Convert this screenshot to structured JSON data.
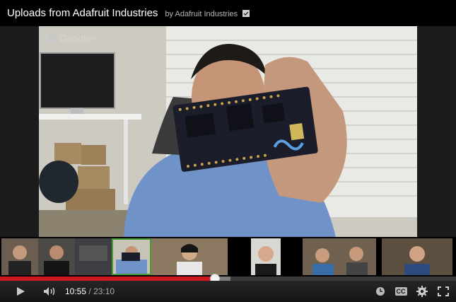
{
  "header": {
    "title": "Uploads from Adafruit Industries",
    "byline": "by Adafruit Industries"
  },
  "video": {
    "watermark": "Google+"
  },
  "participants": [
    {
      "name": "participant-1"
    },
    {
      "name": "participant-2"
    },
    {
      "name": "participant-3"
    },
    {
      "name": "participant-4"
    },
    {
      "name": "participant-5"
    },
    {
      "name": "participant-6"
    },
    {
      "name": "participant-7"
    }
  ],
  "playback": {
    "current_time": "10:55",
    "separator": "/",
    "duration": "23:10",
    "progress_fraction": 0.472,
    "loaded_fraction": 0.505
  },
  "colors": {
    "accent": "#cc181e",
    "active_speaker": "#4b9a3a"
  },
  "icons": {
    "play": "play-icon",
    "volume": "volume-icon",
    "watch_later": "clock-icon",
    "captions": "captions-icon",
    "settings": "gear-icon",
    "fullscreen": "fullscreen-icon"
  },
  "captions_label": "CC"
}
